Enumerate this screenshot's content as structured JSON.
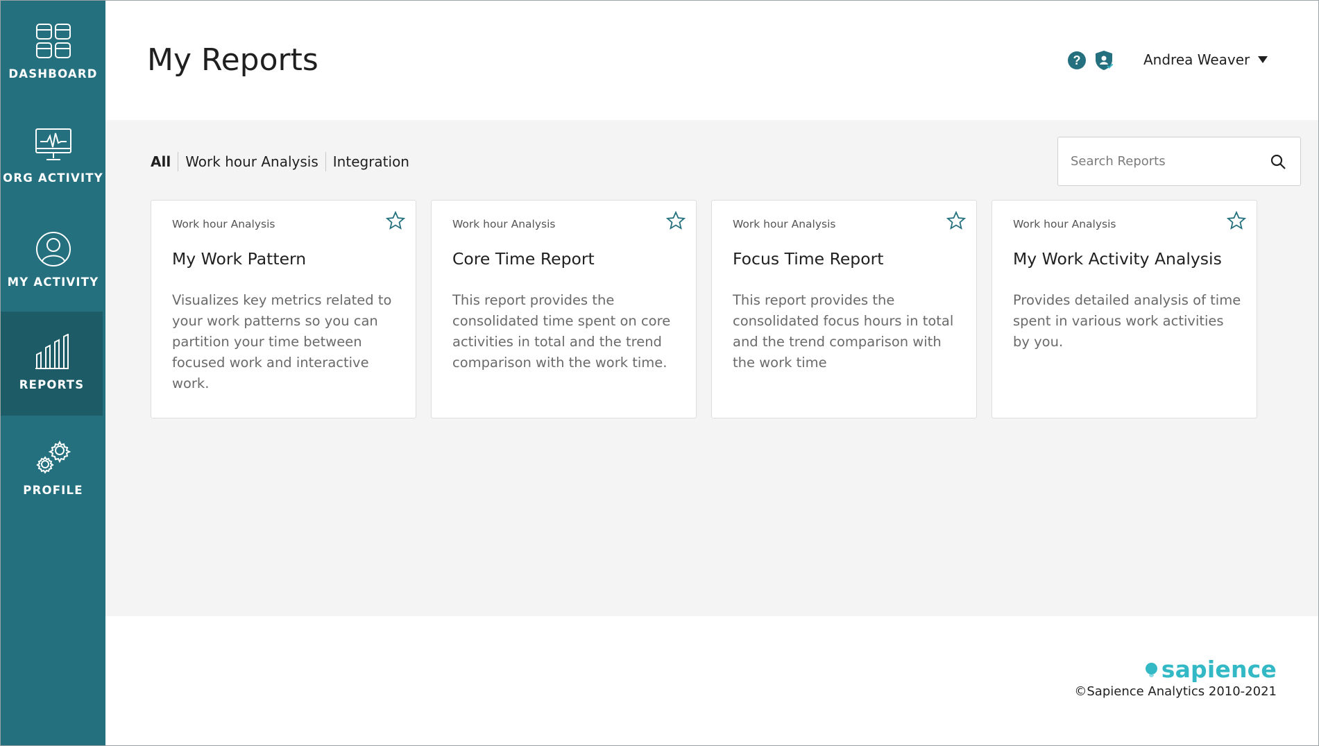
{
  "sidebar": {
    "items": [
      {
        "label": "DASHBOARD",
        "icon": "dashboard-grid-icon"
      },
      {
        "label": "ORG ACTIVITY",
        "icon": "monitor-pulse-icon"
      },
      {
        "label": "MY ACTIVITY",
        "icon": "user-circle-icon"
      },
      {
        "label": "REPORTS",
        "icon": "bar-chart-icon",
        "active": true
      },
      {
        "label": "PROFILE",
        "icon": "gears-icon"
      }
    ]
  },
  "header": {
    "title": "My Reports",
    "help_symbol": "?",
    "user_name": "Andrea Weaver"
  },
  "filters": {
    "items": [
      "All",
      "Work hour Analysis",
      "Integration"
    ],
    "active": "All"
  },
  "search": {
    "placeholder": "Search Reports",
    "value": ""
  },
  "reports": [
    {
      "category": "Work hour Analysis",
      "title": "My Work Pattern",
      "description": "Visualizes key metrics related to your work patterns so you can partition your time between focused work and interactive work."
    },
    {
      "category": "Work hour Analysis",
      "title": "Core Time Report",
      "description": "This report provides the consolidated time spent on core activities in total and the trend comparison with the work time."
    },
    {
      "category": "Work hour Analysis",
      "title": "Focus Time Report",
      "description": "This report provides the consolidated focus hours in total and the trend comparison with the work time"
    },
    {
      "category": "Work hour Analysis",
      "title": "My Work Activity Analysis",
      "description": "Provides detailed analysis of time spent in various work activities by you."
    }
  ],
  "footer": {
    "brand": "sapience",
    "copyright": "©Sapience Analytics 2010-2021"
  },
  "colors": {
    "sidebar": "#24707e",
    "sidebar_active": "#1d5c67",
    "brand": "#33b8c6",
    "background": "#f4f4f4"
  }
}
